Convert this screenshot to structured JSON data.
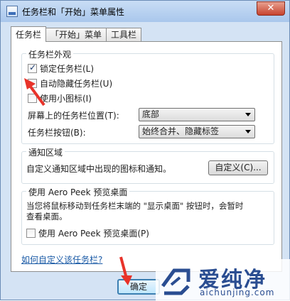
{
  "window": {
    "title": "任务栏和「开始」菜单属性",
    "close_label": "✕"
  },
  "tabs": [
    {
      "label": "任务栏",
      "active": true
    },
    {
      "label": "「开始」菜单",
      "active": false
    },
    {
      "label": "工具栏",
      "active": false
    }
  ],
  "appearance": {
    "title": "任务栏外观",
    "lock_taskbar": {
      "label": "锁定任务栏(L)",
      "checked": true
    },
    "autohide": {
      "label": "自动隐藏任务栏(U)",
      "checked": false
    },
    "small_icons": {
      "label": "使用小图标(I)",
      "checked": false
    },
    "location_label": "屏幕上的任务栏位置(T):",
    "location_value": "底部",
    "buttons_label": "任务栏按钮(B):",
    "buttons_value": "始终合并、隐藏标签"
  },
  "notification": {
    "title": "通知区域",
    "text": "自定义通知区域中出现的图标和通知。",
    "customize_label": "自定义(C)..."
  },
  "aero_peek": {
    "title": "使用 Aero Peek 预览桌面",
    "description_line1": "当您将鼠标移动到任务栏末端的 \"显示桌面\" 按钮时，会暂时",
    "description_line2": "查看桌面。",
    "checkbox": {
      "label": "使用 Aero Peek 预览桌面(P)",
      "checked": false
    }
  },
  "help_link": "如何自定义该任务栏?",
  "ok_label": "确定",
  "watermark": {
    "name": "爱纯净",
    "url": "aichunjing.com"
  },
  "colors": {
    "accent": "#1a5aa6",
    "annotation_arrow": "#e8332a"
  }
}
